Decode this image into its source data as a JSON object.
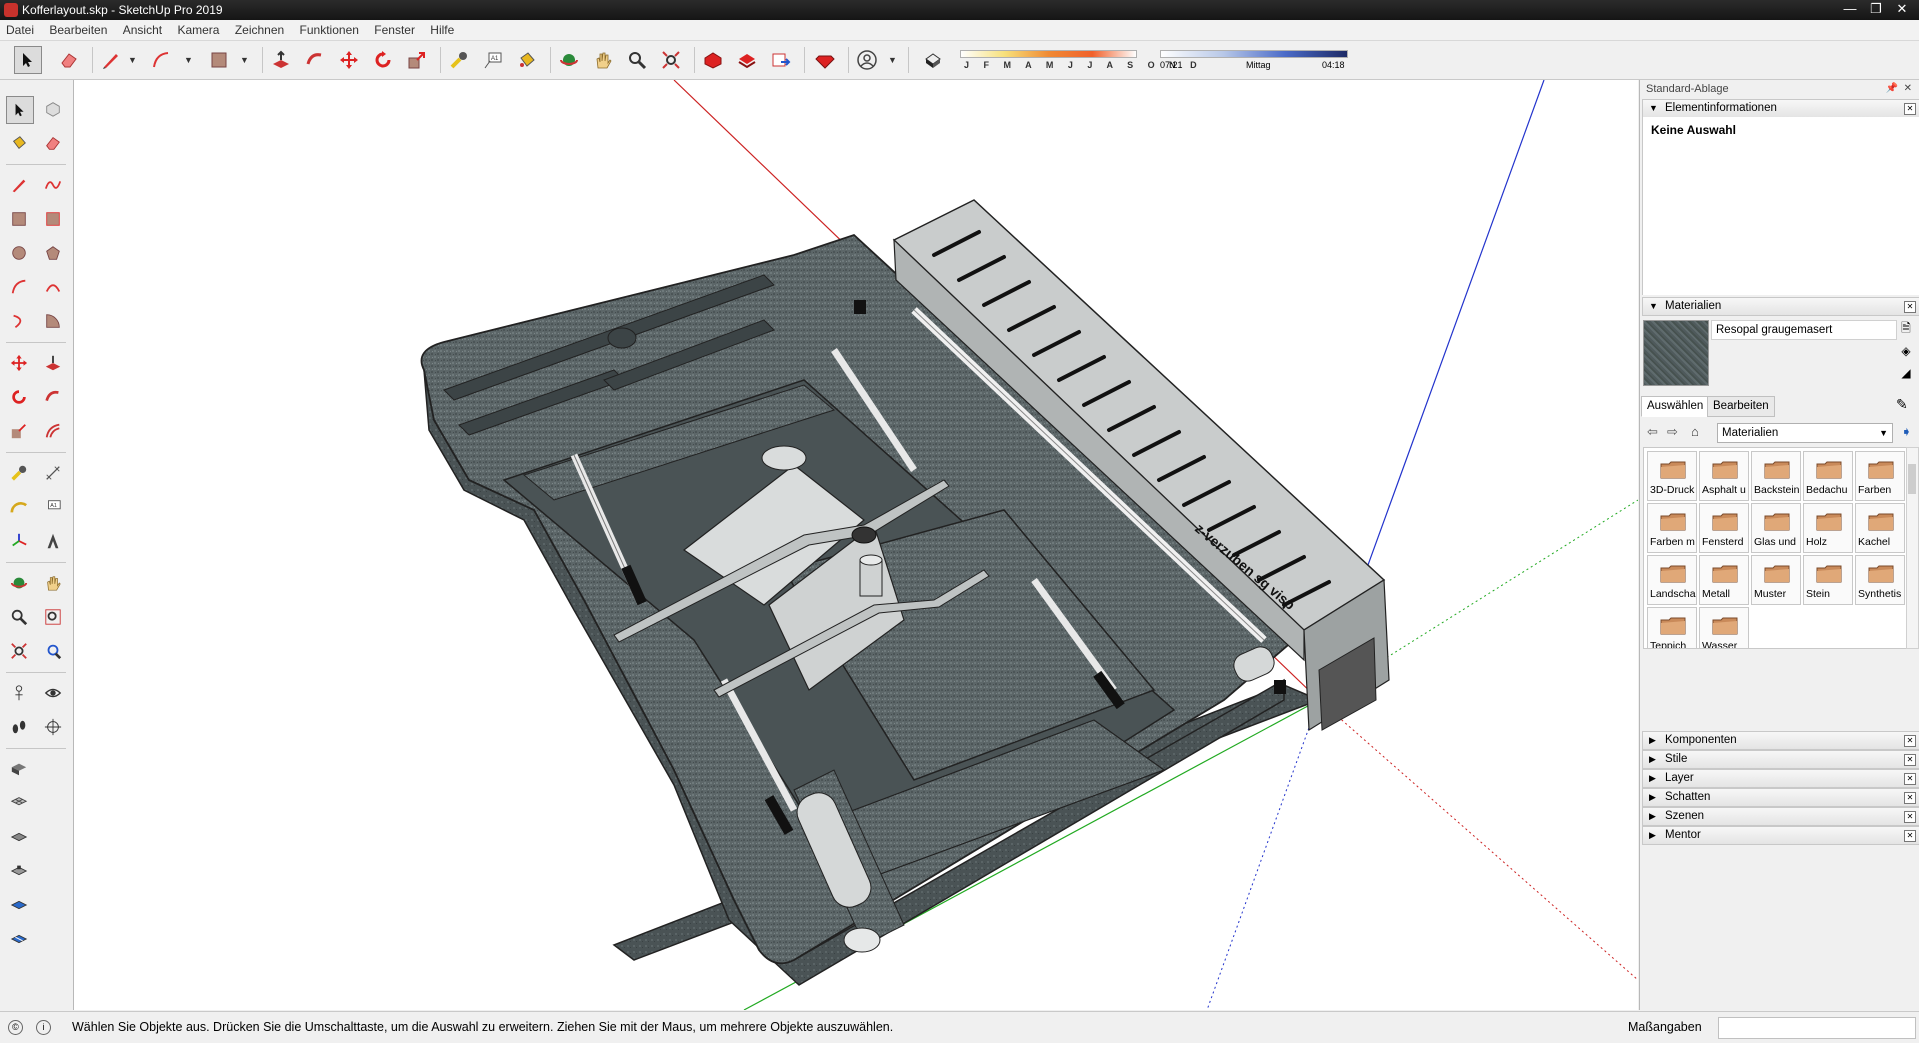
{
  "window": {
    "title": "Kofferlayout.skp - SketchUp Pro 2019",
    "controls": [
      "—",
      "❐",
      "✕"
    ]
  },
  "menu": [
    "Datei",
    "Bearbeiten",
    "Ansicht",
    "Kamera",
    "Zeichnen",
    "Funktionen",
    "Fenster",
    "Hilfe"
  ],
  "shadow": {
    "months": "J F M A M J J A S O N D",
    "time_start": "07:21",
    "time_mid": "Mittag",
    "time_end": "04:18"
  },
  "tray": {
    "title": "Standard-Ablage",
    "entity": {
      "header": "Elementinformationen",
      "status": "Keine Auswahl"
    },
    "materials": {
      "header": "Materialien",
      "current": "Resopal graugemasert",
      "tabs": [
        "Auswählen",
        "Bearbeiten"
      ],
      "library": "Materialien",
      "swatches": [
        "3D-Druck",
        "Asphalt u",
        "Backstein",
        "Bedachu",
        "Farben",
        "Farben m",
        "Fensterd",
        "Glas und",
        "Holz",
        "Kachel",
        "Landscha",
        "Metall",
        "Muster",
        "Stein",
        "Synthetis",
        "Teppich",
        "Wasser"
      ]
    },
    "collapsed": [
      "Komponenten",
      "Stile",
      "Layer",
      "Schatten",
      "Szenen",
      "Mentor"
    ]
  },
  "status": {
    "message": "Wählen Sie Objekte aus. Drücken Sie die Umschalttaste, um die Auswahl zu erweitern. Ziehen Sie mit der Maus, um mehrere Objekte auszuwählen.",
    "measure_label": "Maßangaben",
    "measure_value": ""
  },
  "model": {
    "engraving": "z-verzuben sg visp"
  },
  "colors": {
    "accent_red": "#d6332b",
    "foam": "#5c6668",
    "steel": "#c9cccc",
    "axis_red": "#cc2222",
    "axis_green": "#22aa22",
    "axis_blue": "#2233cc"
  }
}
